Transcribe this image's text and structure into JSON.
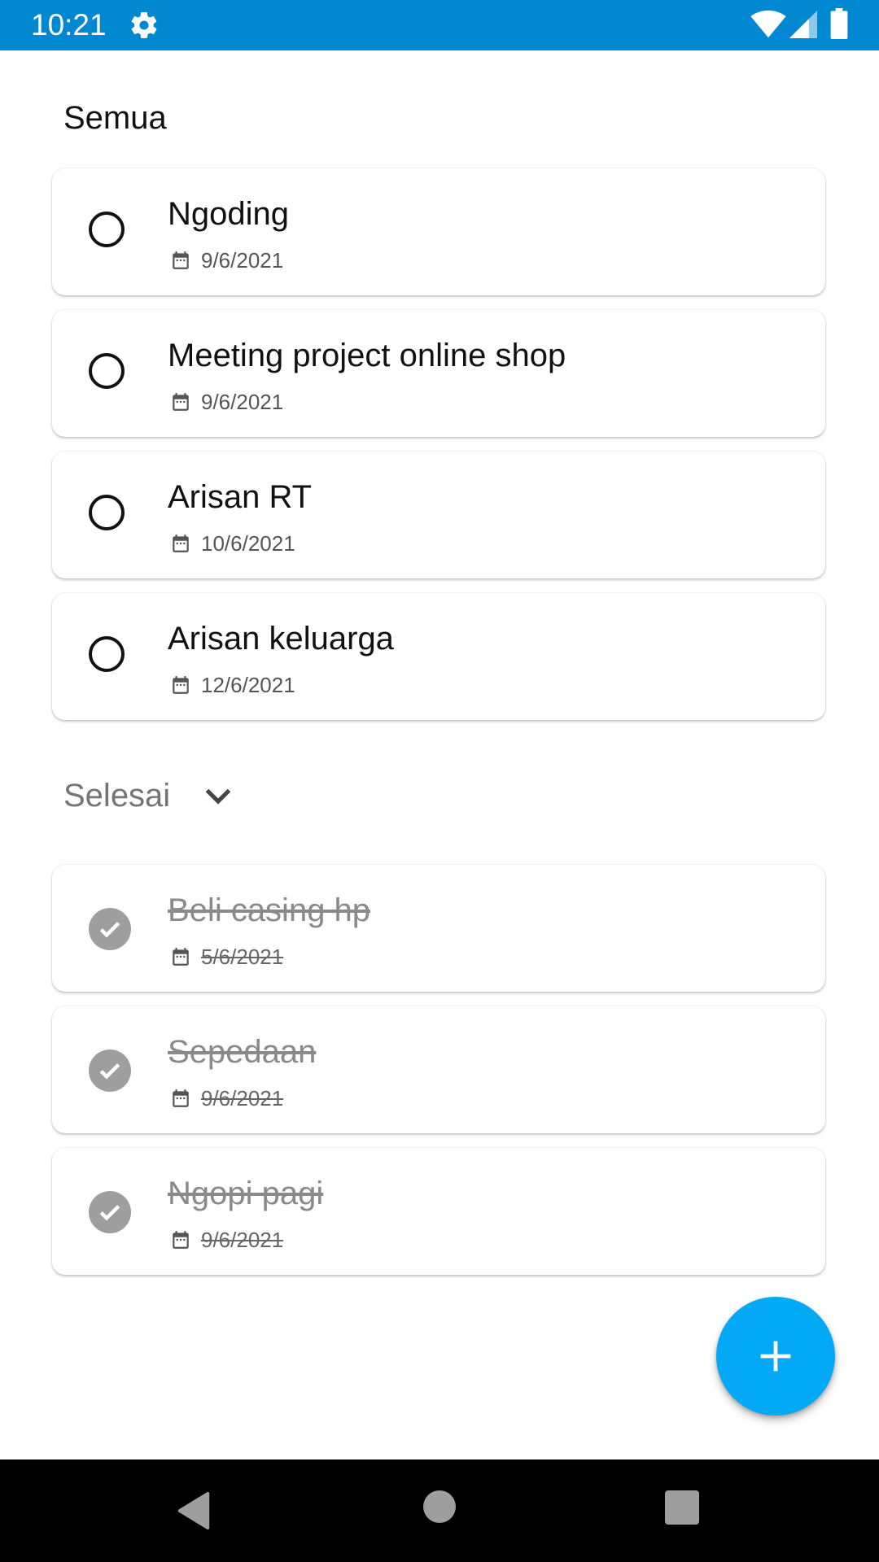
{
  "status_bar": {
    "time": "10:21"
  },
  "sections": {
    "all_title": "Semua",
    "done_title": "Selesai"
  },
  "tasks_pending": [
    {
      "title": "Ngoding",
      "date": "9/6/2021"
    },
    {
      "title": "Meeting project online shop",
      "date": "9/6/2021"
    },
    {
      "title": "Arisan RT",
      "date": "10/6/2021"
    },
    {
      "title": "Arisan keluarga",
      "date": "12/6/2021"
    }
  ],
  "tasks_done": [
    {
      "title": "Beli casing hp",
      "date": "5/6/2021"
    },
    {
      "title": "Sepedaan",
      "date": "9/6/2021"
    },
    {
      "title": "Ngopi pagi",
      "date": "9/6/2021"
    }
  ],
  "colors": {
    "status_bar": "#0288d1",
    "fab": "#03a9f4",
    "done_check": "#9e9e9e"
  },
  "icons": {
    "status": [
      "gear-icon",
      "wifi-icon",
      "signal-icon",
      "battery-icon"
    ],
    "task": [
      "circle-check-icon",
      "calendar-icon",
      "check-done-icon"
    ],
    "fab": "plus-icon",
    "nav": [
      "back-icon",
      "home-icon",
      "recents-icon"
    ]
  }
}
